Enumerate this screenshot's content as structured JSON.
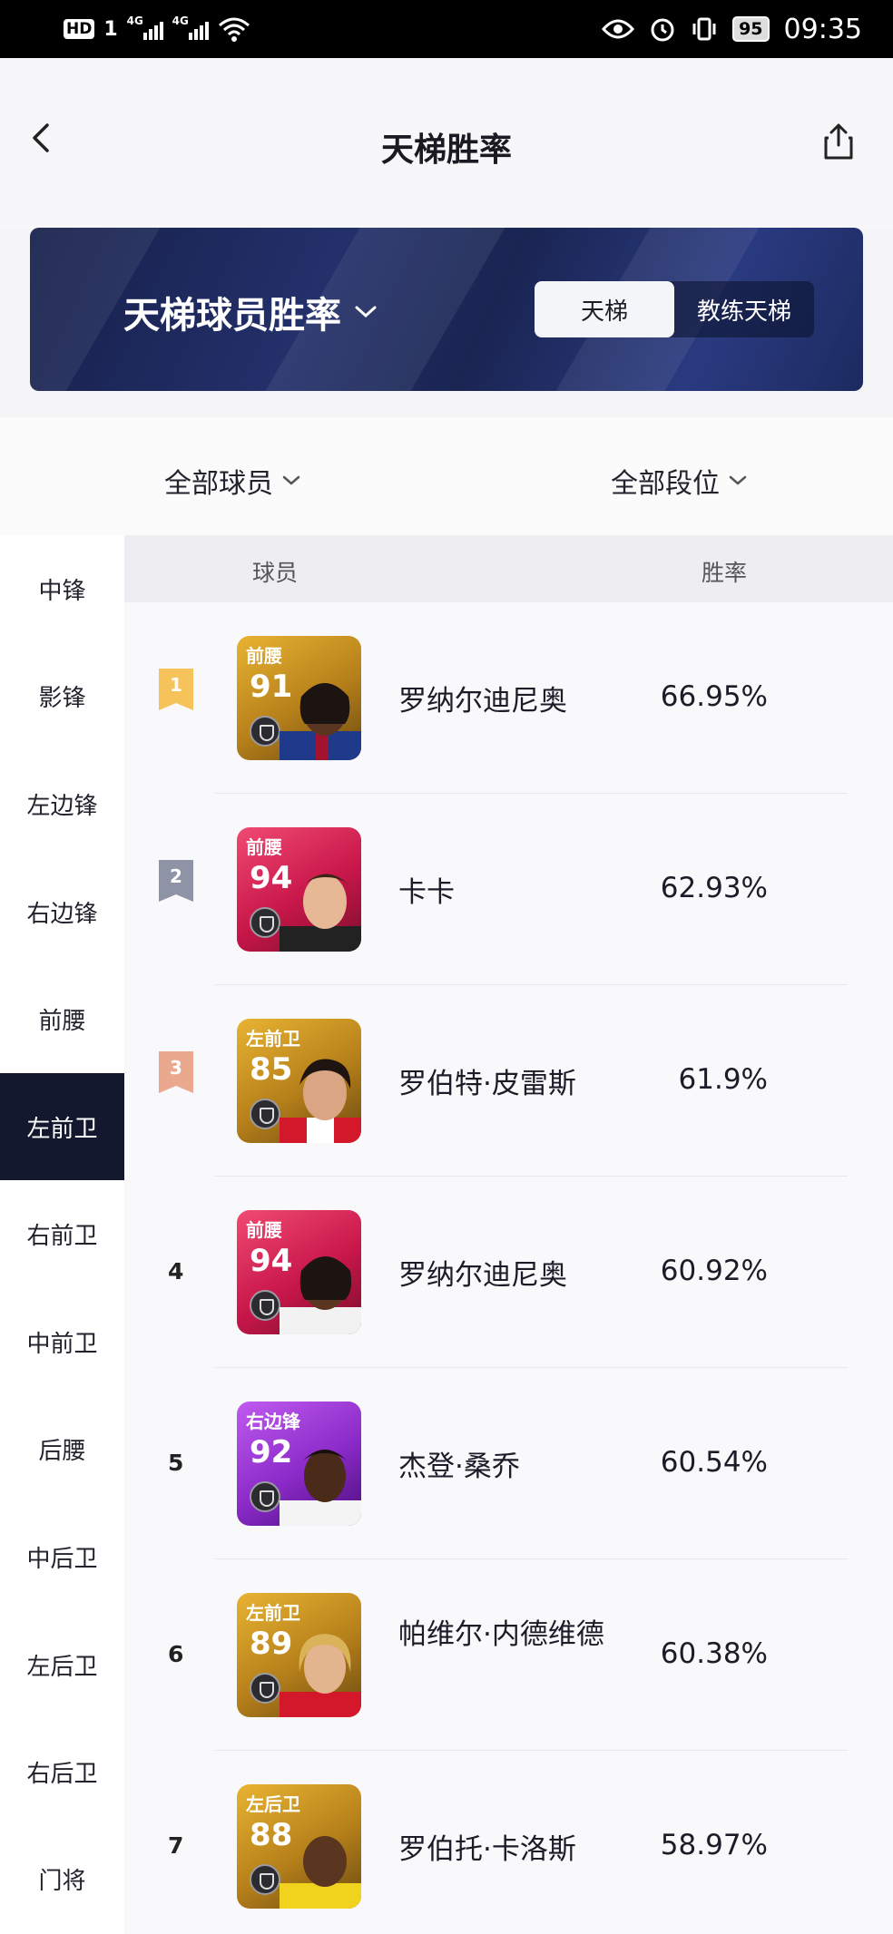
{
  "status_bar": {
    "hd": "HD",
    "sim1": "1",
    "net1": "4G",
    "net2": "4G",
    "battery": "95",
    "time": "09:35"
  },
  "nav": {
    "title": "天梯胜率"
  },
  "banner": {
    "title": "天梯球员胜率",
    "tabs": [
      "天梯",
      "教练天梯"
    ]
  },
  "filters": {
    "players": "全部球员",
    "tier": "全部段位"
  },
  "sidebar": {
    "items": [
      "中锋",
      "影锋",
      "左边锋",
      "右边锋",
      "前腰",
      "左前卫",
      "右前卫",
      "中前卫",
      "后腰",
      "中后卫",
      "左后卫",
      "右后卫",
      "门将"
    ],
    "active": "左前卫"
  },
  "table": {
    "headers": {
      "player": "球员",
      "win_rate": "胜率"
    },
    "rows": [
      {
        "rank": "1",
        "position": "前腰",
        "rating": "91",
        "name": "罗纳尔迪尼奥",
        "win_rate": "66.95%",
        "card_color": "gold"
      },
      {
        "rank": "2",
        "position": "前腰",
        "rating": "94",
        "name": "卡卡",
        "win_rate": "62.93%",
        "card_color": "pink"
      },
      {
        "rank": "3",
        "position": "左前卫",
        "rating": "85",
        "name": "罗伯特·皮雷斯",
        "win_rate": "61.9%",
        "card_color": "gold"
      },
      {
        "rank": "4",
        "position": "前腰",
        "rating": "94",
        "name": "罗纳尔迪尼奥",
        "win_rate": "60.92%",
        "card_color": "pink"
      },
      {
        "rank": "5",
        "position": "右边锋",
        "rating": "92",
        "name": "杰登·桑乔",
        "win_rate": "60.54%",
        "card_color": "purple"
      },
      {
        "rank": "6",
        "position": "左前卫",
        "rating": "89",
        "name": "帕维尔·内德维德",
        "win_rate": "60.38%",
        "card_color": "gold"
      },
      {
        "rank": "7",
        "position": "左后卫",
        "rating": "88",
        "name": "罗伯托·卡洛斯",
        "win_rate": "58.97%",
        "card_color": "gold"
      }
    ]
  },
  "colors": {
    "rank1": "#f6c35a",
    "rank2": "#8f93a6",
    "rank3": "#eaa98e",
    "sidebar_active": "#13182f",
    "banner": "#1d2a60"
  }
}
